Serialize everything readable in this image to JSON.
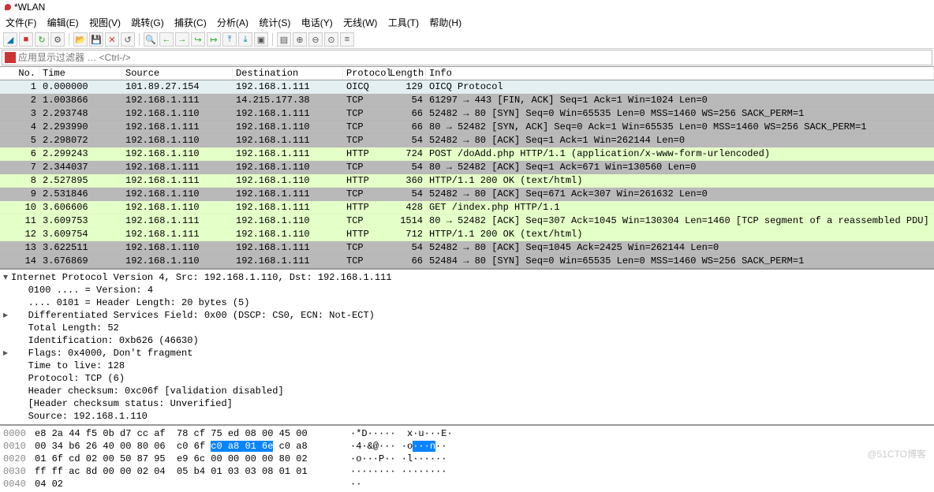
{
  "title": "*WLAN",
  "menu": [
    "文件(F)",
    "编辑(E)",
    "视图(V)",
    "跳转(G)",
    "捕获(C)",
    "分析(A)",
    "统计(S)",
    "电话(Y)",
    "无线(W)",
    "工具(T)",
    "帮助(H)"
  ],
  "filter_placeholder": "应用显示过滤器 … <Ctrl-/>",
  "cols": {
    "no": "No.",
    "time": "Time",
    "src": "Source",
    "dst": "Destination",
    "proto": "Protocol",
    "len": "Length",
    "info": "Info"
  },
  "packets": [
    {
      "no": "1",
      "time": "0.000000",
      "src": "101.89.27.154",
      "dst": "192.168.1.111",
      "proto": "OICQ",
      "len": "129",
      "info": "OICQ Protocol",
      "cls": "bg-cyan"
    },
    {
      "no": "2",
      "time": "1.003866",
      "src": "192.168.1.111",
      "dst": "14.215.177.38",
      "proto": "TCP",
      "len": "54",
      "info": "61297 → 443 [FIN, ACK] Seq=1 Ack=1 Win=1024 Len=0",
      "cls": "bg-grey"
    },
    {
      "no": "3",
      "time": "2.293748",
      "src": "192.168.1.110",
      "dst": "192.168.1.111",
      "proto": "TCP",
      "len": "66",
      "info": "52482 → 80 [SYN] Seq=0 Win=65535 Len=0 MSS=1460 WS=256 SACK_PERM=1",
      "cls": "bg-grey"
    },
    {
      "no": "4",
      "time": "2.293990",
      "src": "192.168.1.111",
      "dst": "192.168.1.110",
      "proto": "TCP",
      "len": "66",
      "info": "80 → 52482 [SYN, ACK] Seq=0 Ack=1 Win=65535 Len=0 MSS=1460 WS=256 SACK_PERM=1",
      "cls": "bg-grey"
    },
    {
      "no": "5",
      "time": "2.298072",
      "src": "192.168.1.110",
      "dst": "192.168.1.111",
      "proto": "TCP",
      "len": "54",
      "info": "52482 → 80 [ACK] Seq=1 Ack=1 Win=262144 Len=0",
      "cls": "bg-grey"
    },
    {
      "no": "6",
      "time": "2.299243",
      "src": "192.168.1.110",
      "dst": "192.168.1.111",
      "proto": "HTTP",
      "len": "724",
      "info": "POST /doAdd.php HTTP/1.1  (application/x-www-form-urlencoded)",
      "cls": "bg-green"
    },
    {
      "no": "7",
      "time": "2.344037",
      "src": "192.168.1.111",
      "dst": "192.168.1.110",
      "proto": "TCP",
      "len": "54",
      "info": "80 → 52482 [ACK] Seq=1 Ack=671 Win=130560 Len=0",
      "cls": "bg-grey"
    },
    {
      "no": "8",
      "time": "2.527895",
      "src": "192.168.1.111",
      "dst": "192.168.1.110",
      "proto": "HTTP",
      "len": "360",
      "info": "HTTP/1.1 200 OK  (text/html)",
      "cls": "bg-green"
    },
    {
      "no": "9",
      "time": "2.531846",
      "src": "192.168.1.110",
      "dst": "192.168.1.111",
      "proto": "TCP",
      "len": "54",
      "info": "52482 → 80 [ACK] Seq=671 Ack=307 Win=261632 Len=0",
      "cls": "bg-grey"
    },
    {
      "no": "10",
      "time": "3.606606",
      "src": "192.168.1.110",
      "dst": "192.168.1.111",
      "proto": "HTTP",
      "len": "428",
      "info": "GET /index.php HTTP/1.1",
      "cls": "bg-green"
    },
    {
      "no": "11",
      "time": "3.609753",
      "src": "192.168.1.111",
      "dst": "192.168.1.110",
      "proto": "TCP",
      "len": "1514",
      "info": "80 → 52482 [ACK] Seq=307 Ack=1045 Win=130304 Len=1460 [TCP segment of a reassembled PDU]",
      "cls": "bg-green"
    },
    {
      "no": "12",
      "time": "3.609754",
      "src": "192.168.1.111",
      "dst": "192.168.1.110",
      "proto": "HTTP",
      "len": "712",
      "info": "HTTP/1.1 200 OK  (text/html)",
      "cls": "bg-green"
    },
    {
      "no": "13",
      "time": "3.622511",
      "src": "192.168.1.110",
      "dst": "192.168.1.111",
      "proto": "TCP",
      "len": "54",
      "info": "52482 → 80 [ACK] Seq=1045 Ack=2425 Win=262144 Len=0",
      "cls": "bg-grey"
    },
    {
      "no": "14",
      "time": "3.676869",
      "src": "192.168.1.110",
      "dst": "192.168.1.111",
      "proto": "TCP",
      "len": "66",
      "info": "52484 → 80 [SYN] Seq=0 Win=65535 Len=0 MSS=1460 WS=256 SACK_PERM=1",
      "cls": "bg-grey"
    }
  ],
  "details": [
    {
      "exp": "v",
      "t": "Internet Protocol Version 4, Src: 192.168.1.110, Dst: 192.168.1.111"
    },
    {
      "exp": " ",
      "t": "   0100 .... = Version: 4"
    },
    {
      "exp": " ",
      "t": "   .... 0101 = Header Length: 20 bytes (5)"
    },
    {
      "exp": ">",
      "t": "   Differentiated Services Field: 0x00 (DSCP: CS0, ECN: Not-ECT)"
    },
    {
      "exp": " ",
      "t": "   Total Length: 52"
    },
    {
      "exp": " ",
      "t": "   Identification: 0xb626 (46630)"
    },
    {
      "exp": ">",
      "t": "   Flags: 0x4000, Don't fragment"
    },
    {
      "exp": " ",
      "t": "   Time to live: 128"
    },
    {
      "exp": " ",
      "t": "   Protocol: TCP (6)"
    },
    {
      "exp": " ",
      "t": "   Header checksum: 0xc06f [validation disabled]"
    },
    {
      "exp": " ",
      "t": "   [Header checksum status: Unverified]"
    },
    {
      "exp": " ",
      "t": "   Source: 192.168.1.110"
    }
  ],
  "hex": {
    "r0": {
      "off": "0000",
      "b": "e8 2a 44 f5 0b d7 cc af  78 cf 75 ed 08 00 45 00",
      "a": "·*D·····  x·u···E·"
    },
    "r1": {
      "off": "0010",
      "b1": "00 34 b6 26 40 00 80 06  c0 6f ",
      "bh": "c0 a8 01 6e",
      "b2": " c0 a8",
      "a1": "·4·&@··· ·o",
      "ah": "···n",
      "a2": "··"
    },
    "r2": {
      "off": "0020",
      "b": "01 6f cd 02 00 50 87 95  e9 6c 00 00 00 00 80 02",
      "a": "·o···P·· ·l······"
    },
    "r3": {
      "off": "0030",
      "b": "ff ff ac 8d 00 00 02 04  05 b4 01 03 03 08 01 01",
      "a": "········ ········"
    },
    "r4": {
      "off": "0040",
      "b": "04 02",
      "a": "··"
    }
  },
  "watermark": "@51CTO博客"
}
